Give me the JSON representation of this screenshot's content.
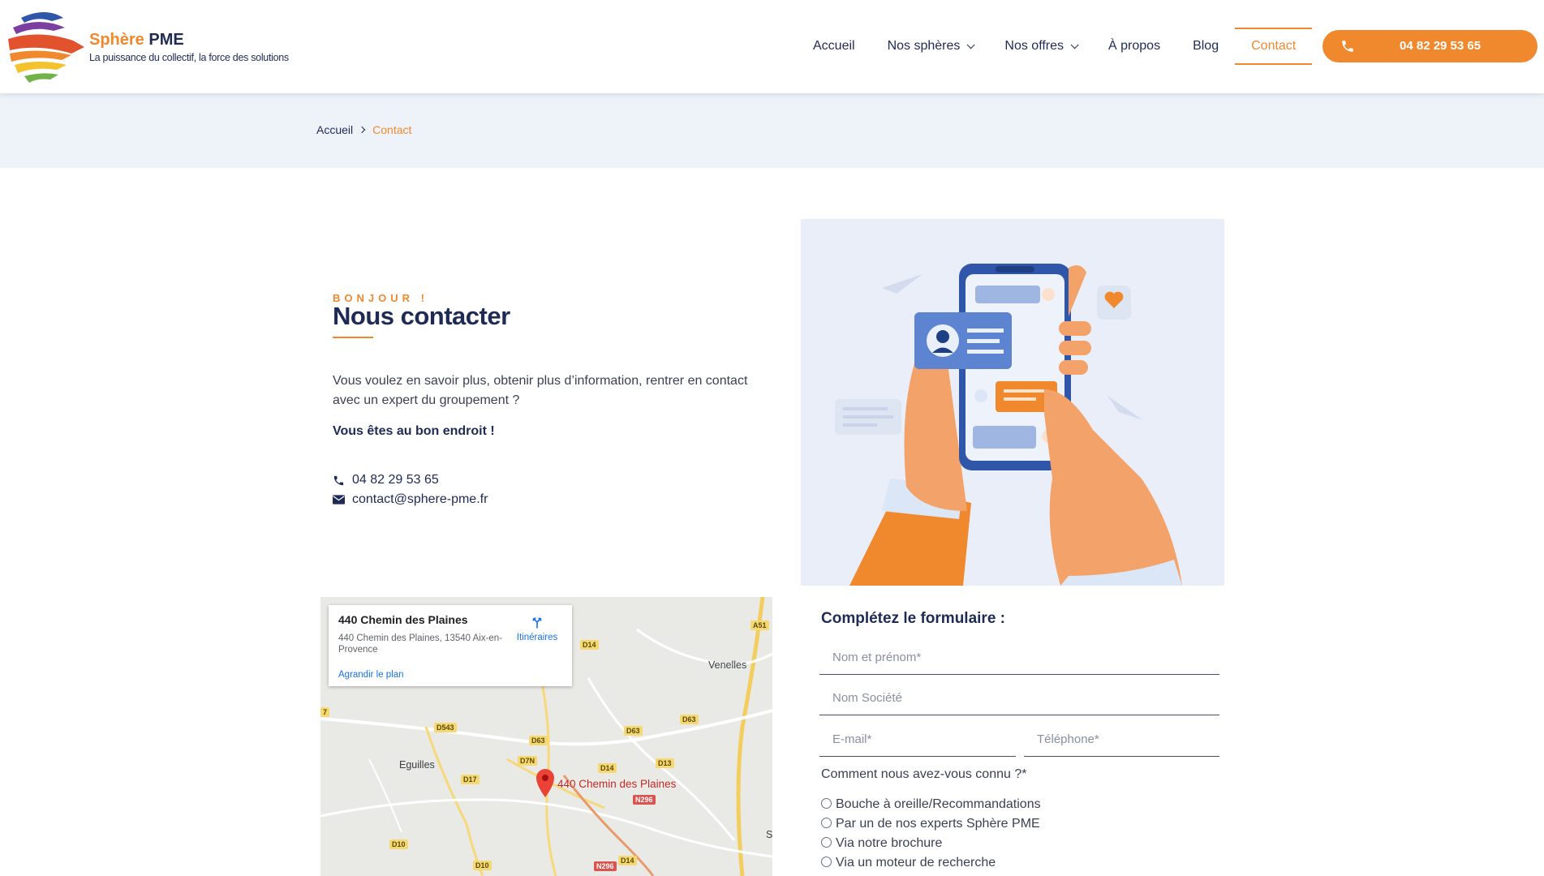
{
  "brand": {
    "name_part1": "Sphère",
    "name_part2": "PME",
    "tagline": "La puissance du collectif, la force des solutions"
  },
  "nav": {
    "items": [
      {
        "label": "Accueil"
      },
      {
        "label": "Nos sphères"
      },
      {
        "label": "Nos offres"
      },
      {
        "label": "À propos"
      },
      {
        "label": "Blog"
      },
      {
        "label": "Contact"
      }
    ],
    "phone_label": "04 82 29 53 65"
  },
  "breadcrumb": {
    "home": "Accueil",
    "current": "Contact"
  },
  "intro": {
    "kicker": "BONJOUR !",
    "title": "Nous contacter",
    "text": "Vous voulez en savoir plus, obtenir plus d’information, rentrer en contact avec un expert du groupement ?",
    "strong": "Vous êtes au bon endroit !",
    "phone": "04 82 29 53 65",
    "email": "contact@sphere-pme.fr"
  },
  "map": {
    "card_title": "440 Chemin des Plaines",
    "card_address": "440 Chemin des Plaines, 13540 Aix-en-Provence",
    "enlarge_link": "Agrandir le plan",
    "directions_label": "Itinéraires",
    "pin_label": "440 Chemin des Plaines",
    "places": {
      "venelles": "Venelles",
      "eguilles": "Eguilles",
      "s": "S"
    },
    "roads": {
      "a51": "A51",
      "d14a": "D14",
      "d543": "D543",
      "d63a": "D63",
      "d63b": "D63",
      "d63c": "D63",
      "d7n": "D7N",
      "d14b": "D14",
      "d13": "D13",
      "d17": "D17",
      "n296a": "N296",
      "d10a": "D10",
      "d10b": "D10",
      "n296b": "N296",
      "d14c": "D14",
      "seven": "7"
    }
  },
  "form": {
    "title": "Complétez le formulaire :",
    "name_placeholder": "Nom et prénom*",
    "company_placeholder": "Nom Société",
    "email_placeholder": "E-mail*",
    "phone_placeholder": "Téléphone*",
    "question": "Comment nous avez-vous connu ?*",
    "options": [
      {
        "label": "Bouche à oreille/Recommandations"
      },
      {
        "label": "Par un de nos experts Sphère PME"
      },
      {
        "label": "Via notre brochure"
      },
      {
        "label": "Via un moteur de recherche"
      }
    ]
  },
  "colors": {
    "accent": "#f0892e",
    "navy": "#1f2a55",
    "band": "#eef2f9"
  }
}
